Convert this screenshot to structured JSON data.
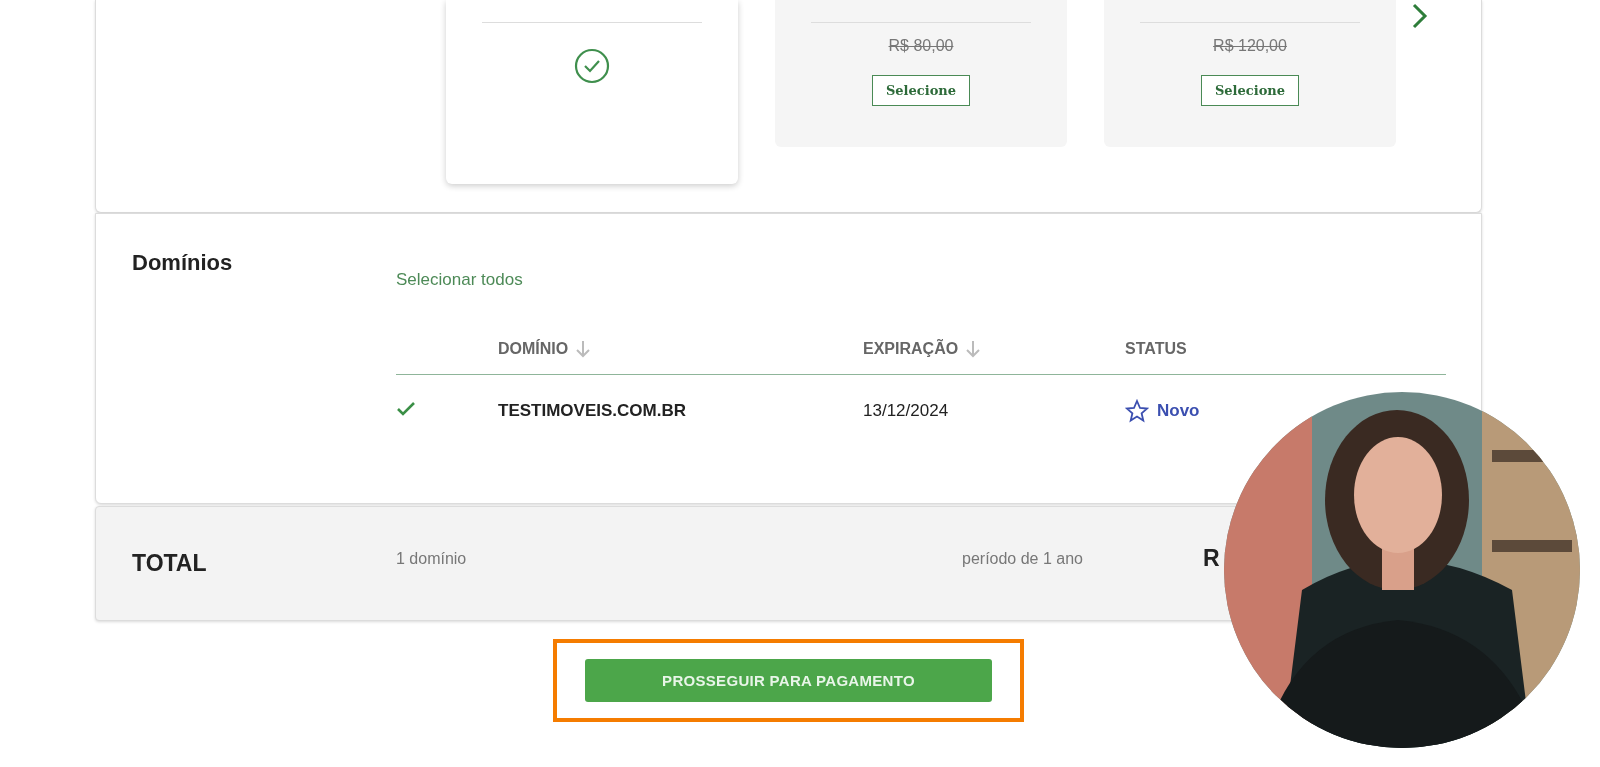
{
  "plans": [
    {
      "selected": true
    },
    {
      "selected": false,
      "old_price": "R$ 80,00",
      "button": "Selecione"
    },
    {
      "selected": false,
      "old_price": "R$ 120,00",
      "button": "Selecione"
    }
  ],
  "domains": {
    "title": "Domínios",
    "select_all": "Selecionar todos",
    "columns": [
      {
        "label": "DOMÍNIO",
        "sortable": true
      },
      {
        "label": "EXPIRAÇÃO",
        "sortable": true
      },
      {
        "label": "STATUS",
        "sortable": false
      }
    ],
    "rows": [
      {
        "checked": true,
        "domain": "TESTIMOVEIS.COM.BR",
        "expiration": "13/12/2024",
        "status": "Novo"
      }
    ]
  },
  "total": {
    "label": "TOTAL",
    "count": "1 domínio",
    "period": "período de 1 ano",
    "value": "R"
  },
  "proceed_button": {
    "label": "PROSSEGUIR PARA PAGAMENTO",
    "highlighted": true
  }
}
